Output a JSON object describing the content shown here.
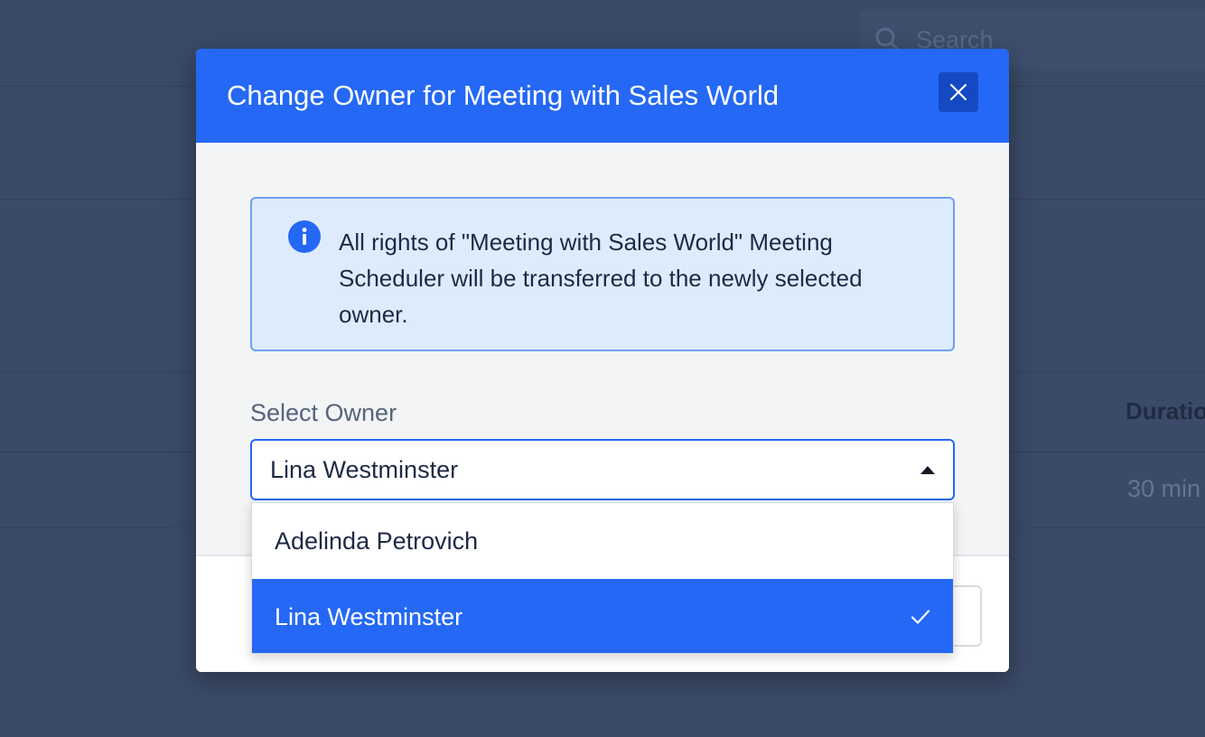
{
  "background": {
    "search_placeholder": "Search",
    "table_header_partial": "Duratio",
    "table_cell_partial": "30 min"
  },
  "modal": {
    "title": "Change Owner for Meeting with Sales World",
    "close_icon": "close-icon",
    "info_icon": "info-icon",
    "info_message": "All rights of \"Meeting with Sales World\" Meeting Scheduler will be transferred to the newly selected owner.",
    "owner_label": "Select Owner",
    "owner_selected": "Lina Westminster",
    "dropdown_icon": "caret-up-icon",
    "options": [
      {
        "label": "Adelinda Petrovich",
        "selected": false
      },
      {
        "label": "Lina Westminster",
        "selected": true
      }
    ],
    "check_icon": "check-icon"
  },
  "colors": {
    "accent": "#2468f5",
    "close_button": "#1549c4",
    "info_background": "#deebfd",
    "info_border": "#6ea0f3",
    "overlay": "#3a4a68"
  }
}
